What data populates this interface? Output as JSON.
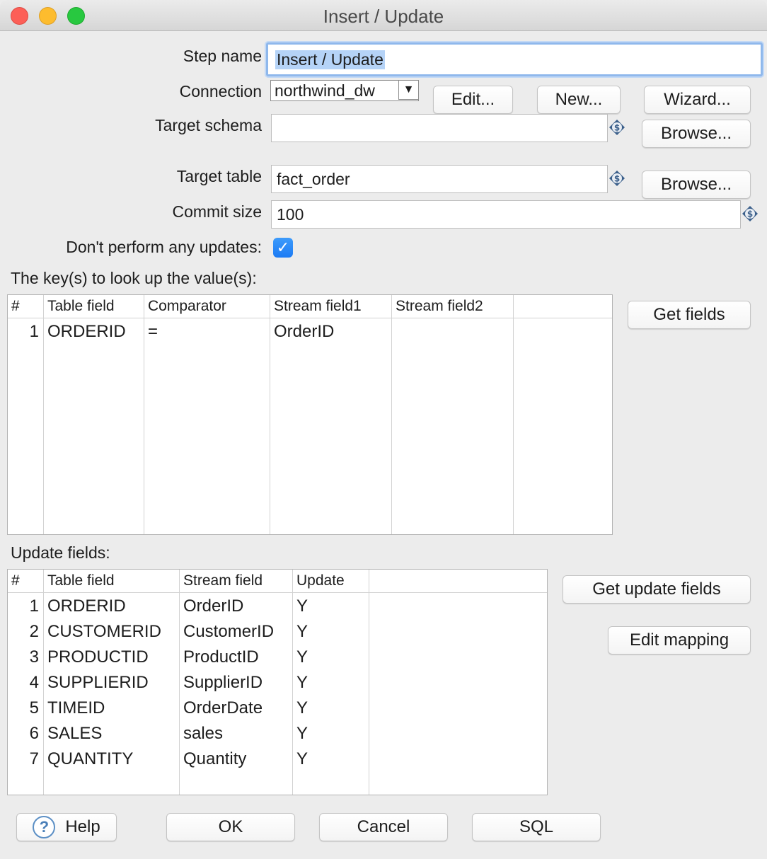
{
  "window": {
    "title": "Insert / Update"
  },
  "form": {
    "step_name_label": "Step name",
    "step_name_value": "Insert / Update",
    "connection_label": "Connection",
    "connection_value": "northwind_dw",
    "target_schema_label": "Target schema",
    "target_schema_value": "",
    "target_table_label": "Target table",
    "target_table_value": "fact_order",
    "commit_size_label": "Commit size",
    "commit_size_value": "100",
    "no_updates_label": "Don't perform any updates:",
    "no_updates_checked": true,
    "checkmark": "✓"
  },
  "buttons": {
    "edit": "Edit...",
    "new": "New...",
    "wizard": "Wizard...",
    "browse_schema": "Browse...",
    "browse_table": "Browse...",
    "get_fields": "Get fields",
    "get_update_fields": "Get update fields",
    "edit_mapping": "Edit mapping",
    "help": "Help",
    "ok": "OK",
    "cancel": "Cancel",
    "sql": "SQL"
  },
  "icons": {
    "help": "?",
    "dropdown": "▼",
    "variable": "variable-icon"
  },
  "keys_table": {
    "title": "The key(s) to look up the value(s):",
    "headers": [
      "#",
      "Table field",
      "Comparator",
      "Stream field1",
      "Stream field2"
    ],
    "rows": [
      {
        "num": "1",
        "table_field": "ORDERID",
        "comparator": "=",
        "stream_field1": "OrderID",
        "stream_field2": ""
      }
    ]
  },
  "update_table": {
    "title": "Update fields:",
    "headers": [
      "#",
      "Table field",
      "Stream field",
      "Update"
    ],
    "rows": [
      {
        "num": "1",
        "table_field": "ORDERID",
        "stream_field": "OrderID",
        "update": "Y"
      },
      {
        "num": "2",
        "table_field": "CUSTOMERID",
        "stream_field": "CustomerID",
        "update": "Y"
      },
      {
        "num": "3",
        "table_field": "PRODUCTID",
        "stream_field": "ProductID",
        "update": "Y"
      },
      {
        "num": "4",
        "table_field": "SUPPLIERID",
        "stream_field": "SupplierID",
        "update": "Y"
      },
      {
        "num": "5",
        "table_field": "TIMEID",
        "stream_field": "OrderDate",
        "update": "Y"
      },
      {
        "num": "6",
        "table_field": "SALES",
        "stream_field": "sales",
        "update": "Y"
      },
      {
        "num": "7",
        "table_field": "QUANTITY",
        "stream_field": "Quantity",
        "update": "Y"
      }
    ]
  }
}
